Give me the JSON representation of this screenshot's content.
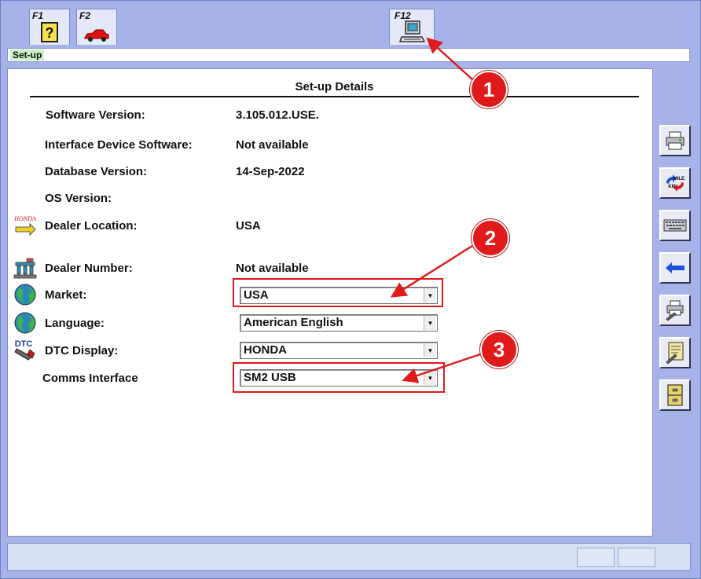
{
  "tabs": [
    {
      "key": "F1",
      "icon": "help-icon"
    },
    {
      "key": "F2",
      "icon": "car-icon"
    },
    {
      "key": "F12",
      "icon": "setup-computer-icon"
    }
  ],
  "breadcrumb": "Set-up",
  "panel": {
    "title": "Set-up Details",
    "rows": [
      {
        "label": "Software Version:",
        "value": "3.105.012.USE."
      },
      {
        "label": "Interface Device Software:",
        "value": "Not available"
      },
      {
        "label": "Database Version:",
        "value": "14-Sep-2022"
      },
      {
        "label": "OS Version:",
        "value": ""
      },
      {
        "label": "Dealer Location:",
        "value": "USA",
        "icon": "honda-location-icon",
        "icon_text": "HONDA"
      },
      {
        "label": "Dealer Number:",
        "value": "Not available",
        "icon": "dealer-number-icon"
      },
      {
        "label": "Market:",
        "value": "USA",
        "icon": "globe-icon"
      },
      {
        "label": "Language:",
        "value": "American English",
        "icon": "globe-icon"
      },
      {
        "label": "DTC Display:",
        "value": "HONDA",
        "icon": "dtc-icon",
        "icon_text": "DTC"
      },
      {
        "label": "Comms Interface",
        "value": "SM2 USB"
      }
    ]
  },
  "side_buttons": [
    {
      "name": "print-button",
      "icon": "printer-icon"
    },
    {
      "name": "mile-km-button",
      "icon": "mile-km-icon",
      "text_top": "MILE",
      "text_bottom": "KM"
    },
    {
      "name": "keyboard-button",
      "icon": "keyboard-icon"
    },
    {
      "name": "back-button",
      "icon": "arrow-left-icon"
    },
    {
      "name": "print-settings-button",
      "icon": "printer-wrench-icon"
    },
    {
      "name": "document-settings-button",
      "icon": "document-wrench-icon"
    },
    {
      "name": "cabinet-button",
      "icon": "cabinet-icon"
    }
  ],
  "annotations": [
    "1",
    "2",
    "3"
  ],
  "colors": {
    "background": "#a7b3e8",
    "annotation_red": "#e01a1a",
    "breadcrumb_green": "#c9f0c4",
    "arrow_blue": "#1e4fd6"
  }
}
